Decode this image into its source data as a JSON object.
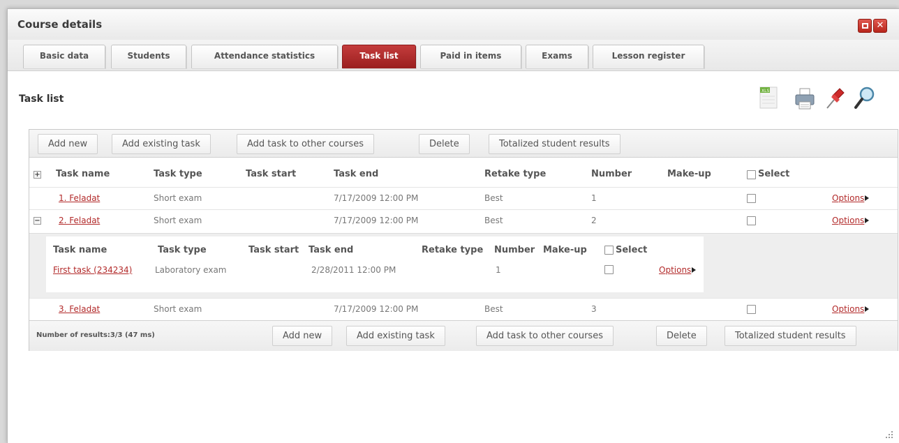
{
  "window": {
    "title": "Course details"
  },
  "tabs": [
    {
      "label": "Basic data",
      "active": false
    },
    {
      "label": "Students",
      "active": false
    },
    {
      "label": "Attendance statistics",
      "active": false
    },
    {
      "label": "Task list",
      "active": true
    },
    {
      "label": "Paid in items",
      "active": false
    },
    {
      "label": "Exams",
      "active": false
    },
    {
      "label": "Lesson register",
      "active": false
    }
  ],
  "section": {
    "title": "Task list"
  },
  "toolbar_icons": [
    "excel-export-icon",
    "print-icon",
    "pin-icon",
    "search-icon"
  ],
  "top_buttons": {
    "add_new": "Add new",
    "add_existing": "Add existing task",
    "add_other": "Add task to other courses",
    "delete": "Delete",
    "totalized": "Totalized student results"
  },
  "table": {
    "headers": {
      "task_name": "Task name",
      "task_type": "Task type",
      "task_start": "Task start",
      "task_end": "Task end",
      "retake_type": "Retake type",
      "number": "Number",
      "makeup": "Make-up",
      "select": "Select"
    },
    "rows": [
      {
        "name": "1. Feladat",
        "type": "Short exam",
        "start": "",
        "end": "7/17/2009 12:00 PM",
        "retake": "Best",
        "number": "1",
        "makeup": "",
        "options": "Options"
      },
      {
        "name": "2. Feladat",
        "type": "Short exam",
        "start": "",
        "end": "7/17/2009 12:00 PM",
        "retake": "Best",
        "number": "2",
        "makeup": "",
        "options": "Options"
      },
      {
        "name": "3. Feladat",
        "type": "Short exam",
        "start": "",
        "end": "7/17/2009 12:00 PM",
        "retake": "Best",
        "number": "3",
        "makeup": "",
        "options": "Options"
      }
    ]
  },
  "subtable": {
    "headers": {
      "task_name": "Task name",
      "task_type": "Task type",
      "task_start": "Task start",
      "task_end": "Task end",
      "retake_type": "Retake type",
      "number": "Number",
      "makeup": "Make-up",
      "select": "Select"
    },
    "rows": [
      {
        "name": "First task (234234)",
        "type": "Laboratory exam",
        "start": "",
        "end": "2/28/2011 12:00 PM",
        "retake": "",
        "number": "1",
        "options": "Options"
      }
    ]
  },
  "footer": {
    "count": "Number of results:3/3 (47 ms)",
    "add_new": "Add new",
    "add_existing": "Add existing task",
    "add_other": "Add task to other courses",
    "delete": "Delete",
    "totalized": "Totalized student results"
  },
  "colors": {
    "accent": "#b22a2a",
    "active_tab": "#a82828"
  }
}
